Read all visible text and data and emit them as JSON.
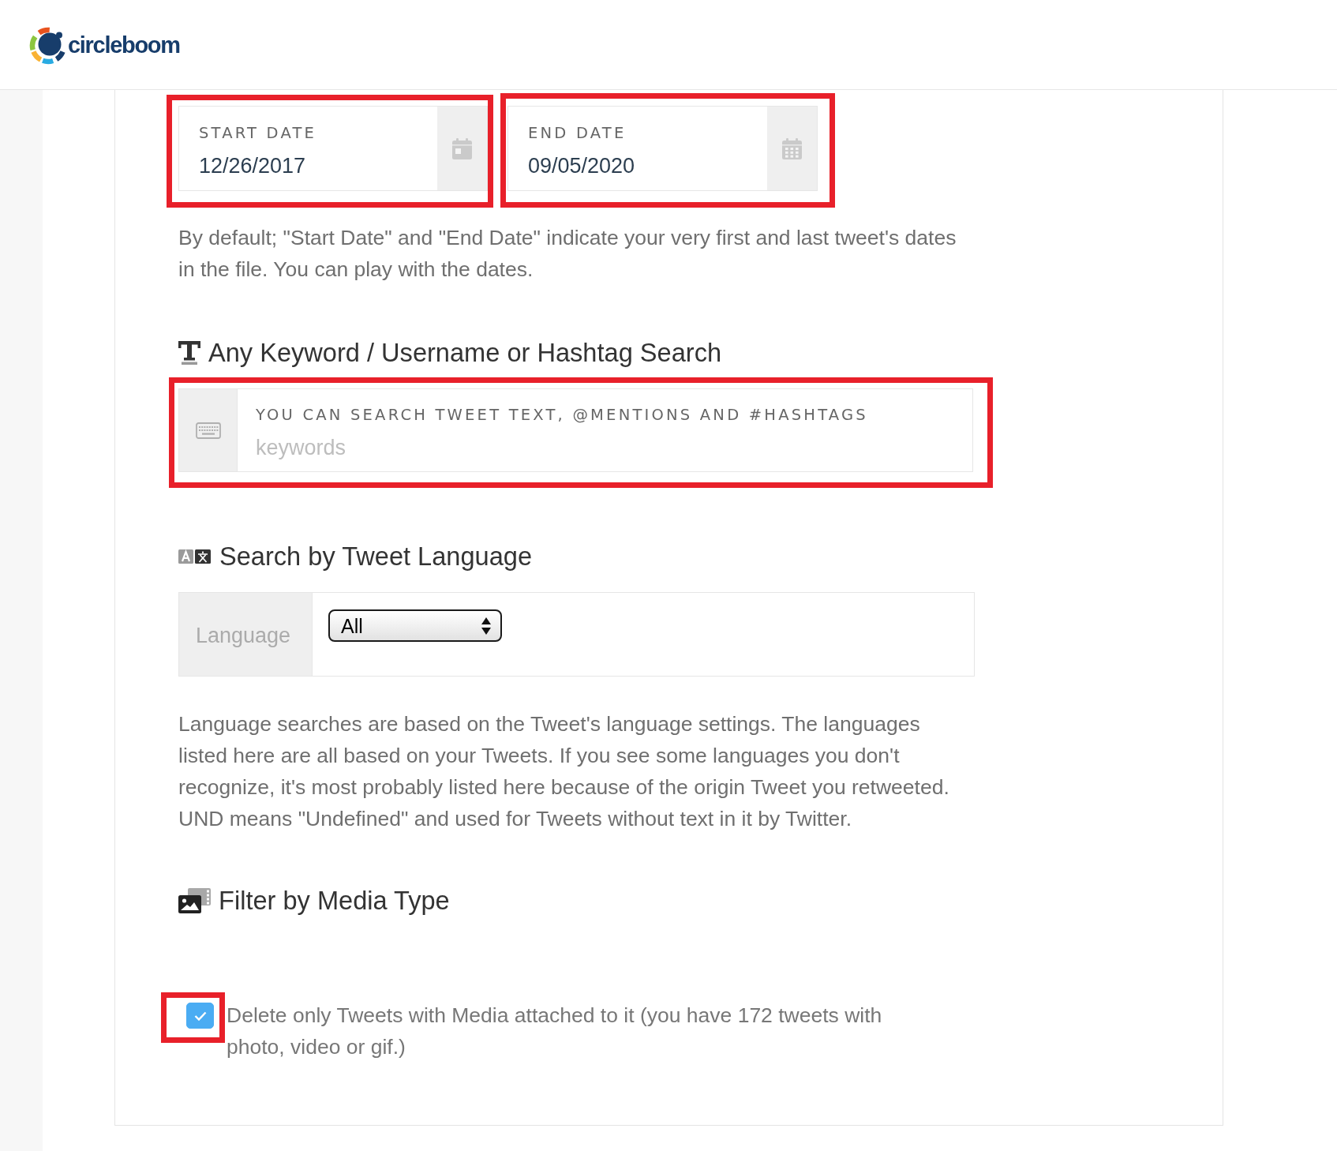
{
  "header": {
    "logo_text": "circleboom"
  },
  "dates": [
    {
      "label": "START DATE",
      "value": "12/26/2017",
      "highlighted": true
    },
    {
      "label": "END DATE",
      "value": "09/05/2020",
      "highlighted": true
    }
  ],
  "dates_note": "By default; \"Start Date\" and \"End Date\" indicate your very first and last tweet's dates in the file. You can play with the dates.",
  "keyword_search": {
    "heading": "Any Keyword / Username or Hashtag Search",
    "label": "YOU CAN SEARCH TWEET TEXT, @MENTIONS AND #HASHTAGS",
    "placeholder": "keywords",
    "highlighted": true
  },
  "language_search": {
    "heading": "Search by Tweet Language",
    "addon": "Language",
    "value": "All",
    "note": "Language searches are based on the Tweet's language settings. The languages listed here are all based on your Tweets. If you see some languages you don't recognize, it's most probably listed here because of the origin Tweet you retweeted. UND means \"Undefined\" and used for Tweets without text in it by Twitter."
  },
  "media_filter": {
    "heading": "Filter by Media Type",
    "checked": true,
    "label": "Delete only Tweets with Media attached to it (you have 172 tweets with photo, video or gif.)",
    "highlighted": true
  }
}
